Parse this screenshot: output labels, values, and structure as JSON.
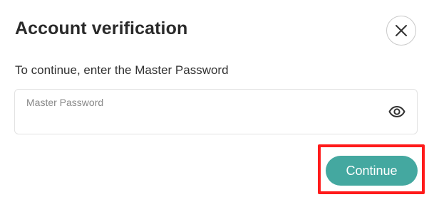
{
  "dialog": {
    "title": "Account verification",
    "instruction": "To continue, enter the Master Password",
    "password_field": {
      "label": "Master Password",
      "value": ""
    },
    "continue_label": "Continue",
    "icons": {
      "close": "close-icon",
      "eye": "eye-icon"
    }
  },
  "colors": {
    "accent": "#44a8a0",
    "highlight": "#ff1a1a",
    "title_text": "#2a2a2a",
    "label_text": "#888888"
  }
}
